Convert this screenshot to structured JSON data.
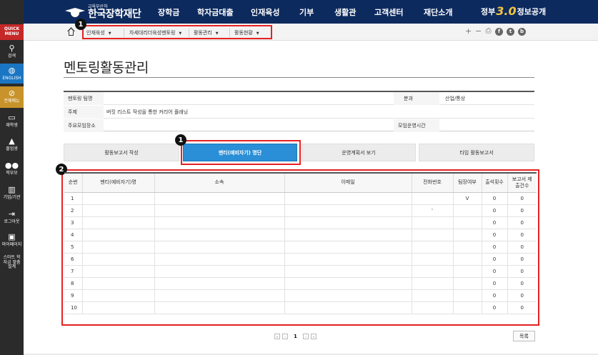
{
  "header": {
    "logo_small": "교육부산하",
    "logo_main": "한국장학재단",
    "nav": [
      "장학금",
      "학자금대출",
      "인재육성",
      "기부",
      "생활관",
      "고객센터",
      "재단소개"
    ],
    "gov_left": "정부",
    "gov_three": "3.0",
    "gov_right": "정보공개"
  },
  "sidebar": {
    "quick": "QUICK MENU",
    "items": [
      "검색",
      "ENGLISH",
      "전체메뉴",
      "재학생",
      "졸업생",
      "학부모",
      "기업/기관",
      "로그아웃",
      "마이페이지",
      "스마트 학자금 맞춤설계"
    ]
  },
  "breadcrumb": [
    "인재육성",
    "차세대리더육성멘토링",
    "활동관리",
    "활동현황"
  ],
  "tools": {
    "plus": "+",
    "minus": "−",
    "print": "⎙",
    "facebook": "f",
    "twitter": "t",
    "blog": "b"
  },
  "badges": [
    "1",
    "1",
    "2"
  ],
  "page_title": "멘토링활동관리",
  "info": {
    "team_label": "멘토링 팀명",
    "team_value": "",
    "field_label": "분과",
    "field_value": "산업/통상",
    "topic_label": "주제",
    "topic_value": "버킷 리스트 작성을 통한 커리어 플래닝",
    "place_label": "주요모임장소",
    "place_value": "",
    "time_label": "모임운영시간",
    "time_value": ""
  },
  "tabs": [
    "활동보고서 작성",
    "멘티(예비자기) 명단",
    "운영계획서 보기",
    "타임 활동보고서"
  ],
  "table": {
    "headers": [
      "순번",
      "멘티(예비자기)명",
      "소속",
      "이메일",
      "전화번호",
      "팀장여부",
      "출석횟수",
      "보고서 제출건수"
    ],
    "rows": [
      [
        "1",
        "",
        "",
        "",
        "",
        "V",
        "0",
        "0"
      ],
      [
        "2",
        "",
        "",
        "",
        "'",
        "",
        "0",
        "0"
      ],
      [
        "3",
        "",
        "",
        "",
        "",
        "",
        "0",
        "0"
      ],
      [
        "4",
        "",
        "",
        "",
        "",
        "",
        "0",
        "0"
      ],
      [
        "5",
        "",
        "",
        "",
        "",
        "",
        "0",
        "0"
      ],
      [
        "6",
        "",
        "",
        "",
        "",
        "",
        "0",
        "0"
      ],
      [
        "7",
        "",
        "",
        "",
        "",
        "",
        "0",
        "0"
      ],
      [
        "8",
        "",
        "",
        "",
        "",
        "",
        "0",
        "0"
      ],
      [
        "9",
        "",
        "",
        "",
        "",
        "",
        "0",
        "0"
      ],
      [
        "10",
        "",
        "",
        "",
        "",
        "",
        "0",
        "0"
      ]
    ]
  },
  "pagination": {
    "first": "«",
    "prev": "‹",
    "current": "1",
    "next": "›",
    "last": "»"
  },
  "list_button": "목록",
  "colors": {
    "header_bg": "#0d2a5e",
    "active_tab": "#2a8fd6",
    "highlight": "#e52222"
  }
}
